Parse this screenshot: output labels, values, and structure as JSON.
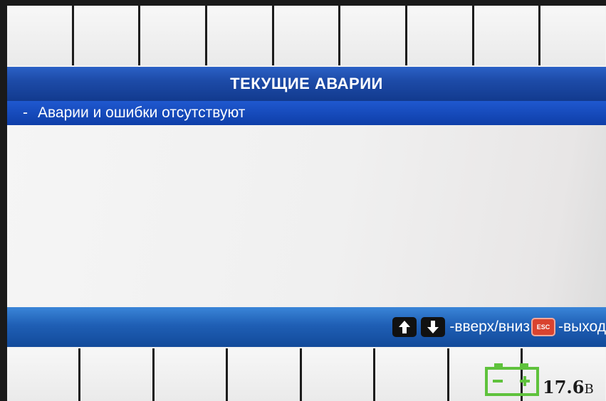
{
  "title": "ТЕКУЩИЕ АВАРИИ",
  "alarms": {
    "items": [
      {
        "bullet": "-",
        "text": "Аварии и ошибки отсутствуют",
        "selected": true
      }
    ]
  },
  "status_bar": {
    "up_icon": "arrow-up-icon",
    "down_icon": "arrow-down-icon",
    "nav_hint": "-вверх/вниз",
    "esc_label": "ESC",
    "exit_hint": "-выход"
  },
  "battery": {
    "icon": "battery-icon",
    "voltage": "17.6",
    "unit": "В"
  },
  "colors": {
    "title_bar": "#1d4ba8",
    "selected_row": "#0e3ea8",
    "status_bar": "#1f5fb5",
    "esc_key": "#d9432f",
    "battery": "#5fc23c"
  }
}
